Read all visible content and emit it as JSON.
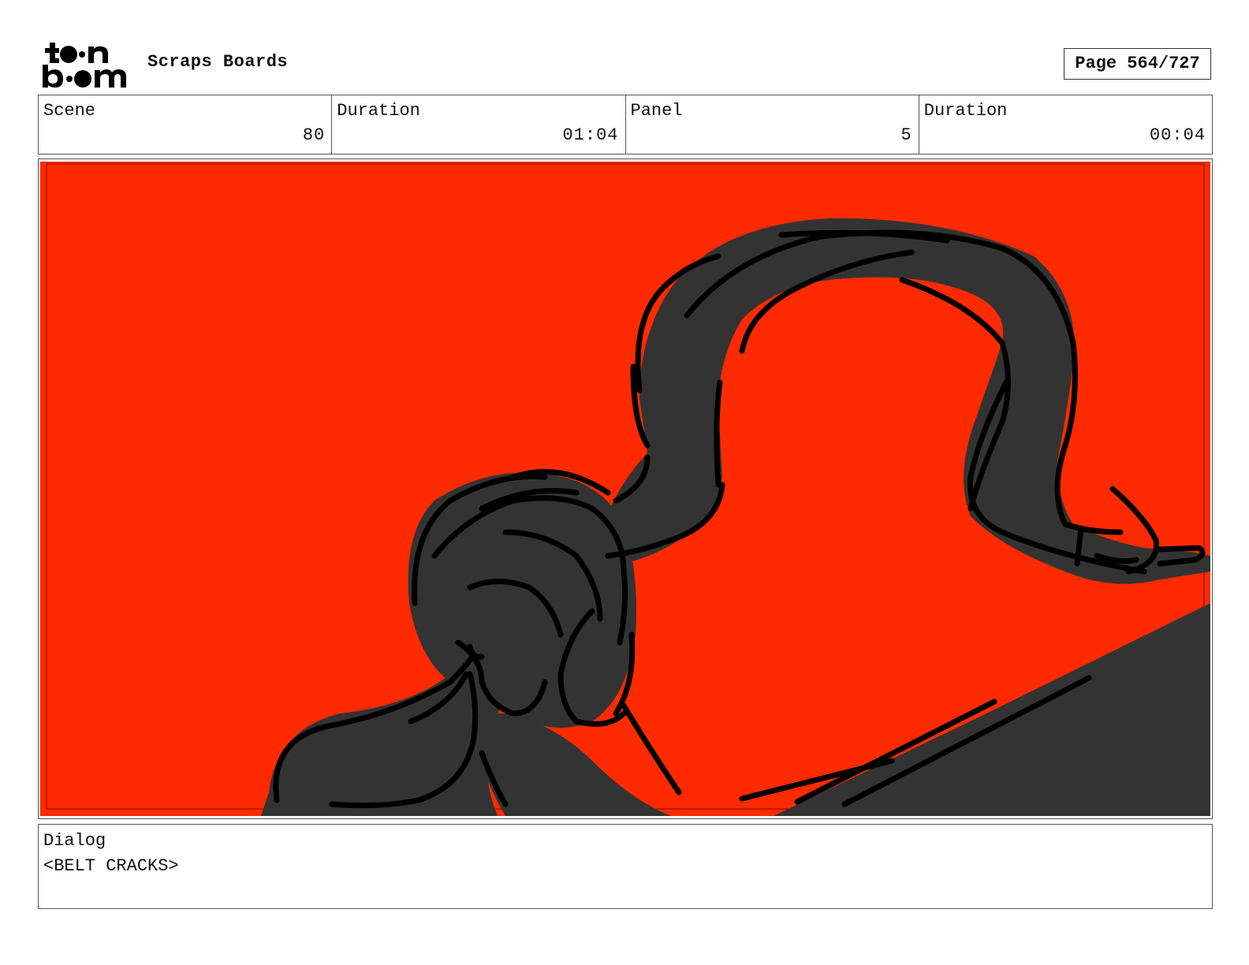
{
  "header": {
    "logo_text": "toon boom",
    "board_title": "Scraps Boards",
    "page_indicator": "Page 564/727"
  },
  "info": {
    "scene_label": "Scene",
    "scene_value": "80",
    "scene_duration_label": "Duration",
    "scene_duration_value": "01:04",
    "panel_label": "Panel",
    "panel_value": "5",
    "panel_duration_label": "Duration",
    "panel_duration_value": "00:04"
  },
  "panel": {
    "background_color": "#ff2a00",
    "fill_color": "#333333",
    "line_color": "#000000"
  },
  "dialog": {
    "label": "Dialog",
    "text": "<BELT CRACKS>"
  }
}
